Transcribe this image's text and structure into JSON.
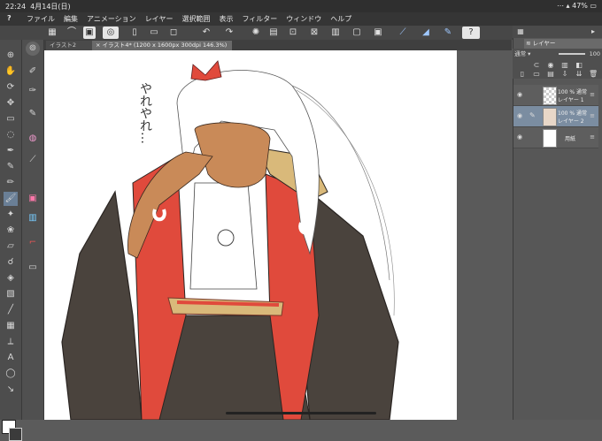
{
  "status": {
    "time": "22:24",
    "date": "4月14日(日)",
    "battery": "47%"
  },
  "menu": {
    "logo": "?",
    "items": [
      "ファイル",
      "編集",
      "アニメーション",
      "レイヤー",
      "選択範囲",
      "表示",
      "フィルター",
      "ウィンドウ",
      "ヘルプ"
    ]
  },
  "tabs": [
    {
      "label": "イラスト2"
    },
    {
      "label": "イラスト4* (1200 x 1600px 300dpi 146.3%)"
    }
  ],
  "layers_panel": {
    "title": "レイヤー",
    "blend_mode": "通常",
    "opacity": "100",
    "layers": [
      {
        "name": "レイヤー 1",
        "opacity_mode": "100 % 通常",
        "selected": false
      },
      {
        "name": "レイヤー 2",
        "opacity_mode": "100 % 通常",
        "selected": true
      },
      {
        "name": "用紙",
        "opacity_mode": "",
        "selected": false
      }
    ]
  },
  "canvas": {
    "annotation": "やれやれ…"
  },
  "colors": {
    "accent_red": "#e04a3c",
    "skin": "#c98a58",
    "dark_cloth": "#4a433d",
    "gold_trim": "#d9b97a",
    "selected_layer": "#7b8da1"
  }
}
